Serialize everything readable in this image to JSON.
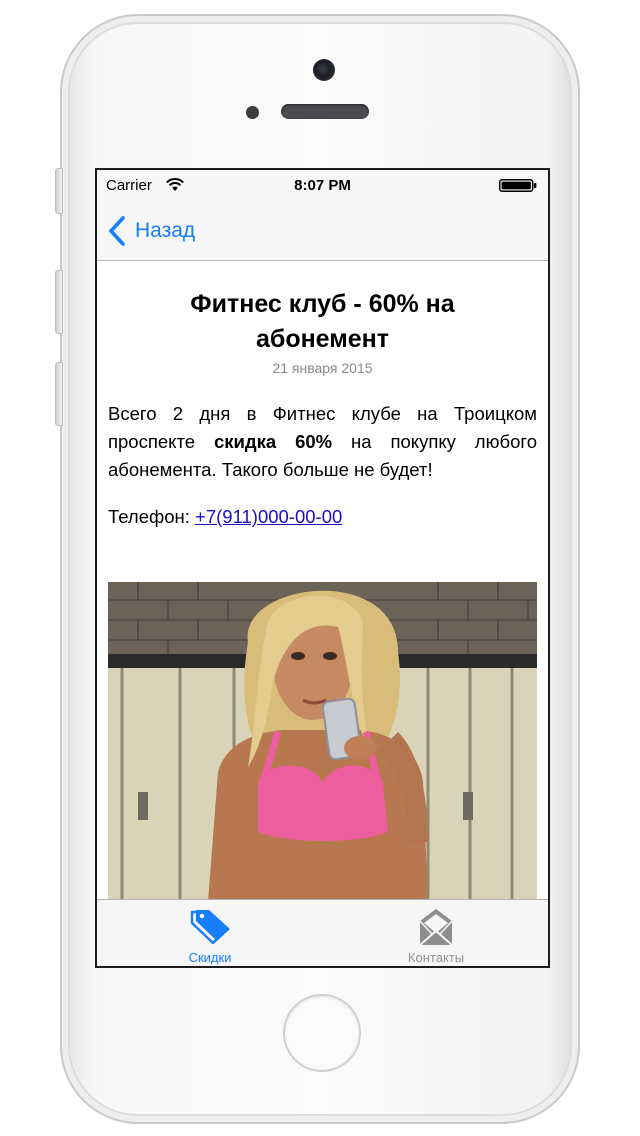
{
  "status_bar": {
    "carrier": "Carrier",
    "time": "8:07 PM",
    "wifi_icon": "wifi-icon",
    "battery_icon": "battery-icon"
  },
  "nav_bar": {
    "back_label": "Назад",
    "back_icon": "chevron-left-icon"
  },
  "article": {
    "title": "Фитнес клуб - 60% на абонемент",
    "date": "21 января 2015",
    "body_before": "Всего 2 дня в Фитнес клубе на Троицком проспекте ",
    "body_bold": "скидка 60%",
    "body_after": " на покупку любого абонемента. Такого больше не будет!",
    "phone_label": "Телефон: ",
    "phone_number": "+7(911)000-00-00"
  },
  "tab_bar": {
    "tabs": [
      {
        "label": "Скидки",
        "icon": "tags-icon",
        "active": true
      },
      {
        "label": "Контакты",
        "icon": "envelope-icon",
        "active": false
      }
    ]
  },
  "colors": {
    "accent": "#167efb",
    "link": "#1a0dcc",
    "inactive_tab": "#929292",
    "date_text": "#8a8a8a"
  }
}
